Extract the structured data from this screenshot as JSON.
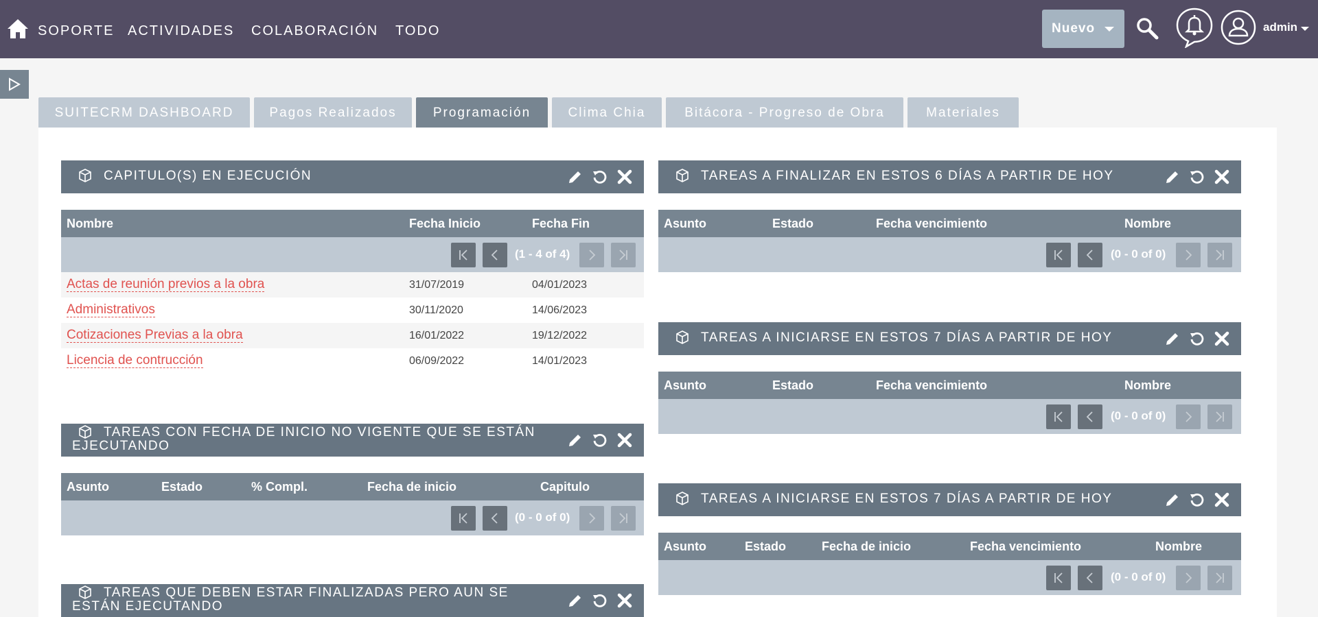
{
  "nav": {
    "items": [
      "SOPORTE",
      "ACTIVIDADES",
      "COLABORACIÓN",
      "TODO"
    ],
    "nuevo_label": "Nuevo",
    "user": "admin"
  },
  "tabs": [
    {
      "label": "SUITECRM DASHBOARD",
      "active": false
    },
    {
      "label": "Pagos Realizados",
      "active": false
    },
    {
      "label": "Programación",
      "active": true
    },
    {
      "label": "Clima Chia",
      "active": false
    },
    {
      "label": "Bitácora - Progreso de Obra",
      "active": false
    },
    {
      "label": "Materiales",
      "active": false
    }
  ],
  "dashlets": {
    "capitulos": {
      "title": "CAPITULO(S) EN EJECUCIÓN",
      "columns": [
        "Nombre",
        "Fecha Inicio",
        "Fecha Fin"
      ],
      "pager": "(1 - 4 of 4)",
      "rows": [
        {
          "nombre": "Actas de reunión previos a la obra",
          "inicio": "31/07/2019",
          "fin": "04/01/2023"
        },
        {
          "nombre": "Administrativos",
          "inicio": "30/11/2020",
          "fin": "14/06/2023"
        },
        {
          "nombre": "Cotizaciones Previas a la obra",
          "inicio": "16/01/2022",
          "fin": "19/12/2022"
        },
        {
          "nombre": "Licencia de contrucción",
          "inicio": "06/09/2022",
          "fin": "14/01/2023"
        }
      ]
    },
    "no_vigente": {
      "title": "TAREAS CON FECHA DE INICIO NO VIGENTE QUE SE ESTÁN EJECUTANDO",
      "columns": [
        "Asunto",
        "Estado",
        "% Compl.",
        "Fecha de inicio",
        "Capitulo"
      ],
      "pager": "(0 - 0 of 0)"
    },
    "deben_finalizadas": {
      "title": "TAREAS QUE DEBEN ESTAR FINALIZADAS PERO AUN SE ESTÁN EJECUTANDO"
    },
    "finalizar6": {
      "title": "TAREAS A FINALIZAR EN ESTOS 6 DÍAS A PARTIR DE HOY",
      "columns": [
        "Asunto",
        "Estado",
        "Fecha vencimiento",
        "Nombre"
      ],
      "pager": "(0 - 0 of 0)"
    },
    "iniciarse7a": {
      "title": "TAREAS A INICIARSE EN ESTOS 7 DÍAS A PARTIR DE HOY",
      "columns": [
        "Asunto",
        "Estado",
        "Fecha vencimiento",
        "Nombre"
      ],
      "pager": "(0 - 0 of 0)"
    },
    "iniciarse7b": {
      "title": "TAREAS A INICIARSE EN ESTOS 7 DÍAS A PARTIR DE HOY",
      "columns": [
        "Asunto",
        "Estado",
        "Fecha de inicio",
        "Fecha vencimiento",
        "Nombre"
      ],
      "pager": "(0 - 0 of 0)"
    }
  },
  "colors": {
    "topbar": "#534d64",
    "dashlet_header": "#677582",
    "table_header": "#778591",
    "pager_bg": "#bfc9d3",
    "link": "#e0524f"
  },
  "icons": [
    "home-icon",
    "search-icon",
    "bell-icon",
    "user-icon",
    "cube-icon",
    "pencil-icon",
    "refresh-icon",
    "close-icon",
    "first-page-icon",
    "prev-page-icon",
    "next-page-icon",
    "last-page-icon"
  ]
}
